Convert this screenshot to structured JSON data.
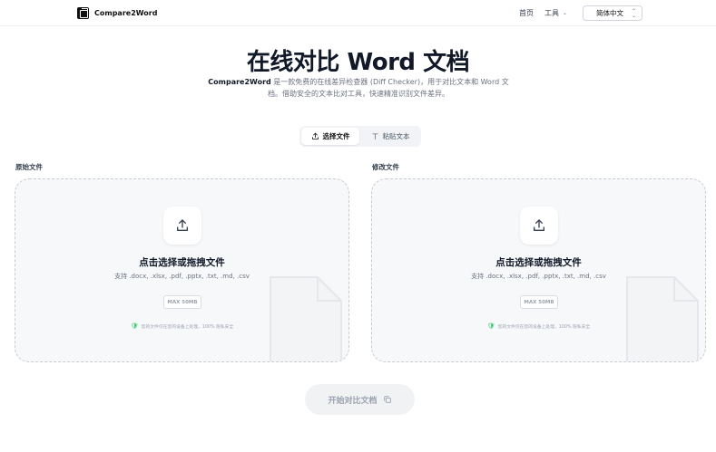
{
  "header": {
    "brand": "Compare2Word",
    "nav_home": "首页",
    "nav_tools": "工具",
    "language": "简体中文"
  },
  "hero": {
    "title": "在线对比 Word 文档",
    "subtitle_brand": "Compare2Word",
    "subtitle_rest": " 是一款免费的在线差异检查器 (Diff Checker)，用于对比文本和 Word 文档。借助安全的文本比对工具，快速精准识别文件差异。"
  },
  "mode_toggle": {
    "file_tab": "选择文件",
    "paste_tab": "粘贴文本",
    "active": "file"
  },
  "panels": {
    "original": {
      "label": "原始文件",
      "drop_title": "点击选择或拖拽文件",
      "formats": "支持 .docx, .xlsx, .pdf, .pptx, .txt, .md, .csv",
      "max_size": "MAX 50MB",
      "secure_note": "您的文件仅在您的设备上处理，100% 隐私安全"
    },
    "modified": {
      "label": "修改文件",
      "drop_title": "点击选择或拖拽文件",
      "formats": "支持 .docx, .xlsx, .pdf, .pptx, .txt, .md, .csv",
      "max_size": "MAX 50MB",
      "secure_note": "您的文件仅在您的设备上处理，100% 隐私安全"
    }
  },
  "compare_button": "开始对比文档",
  "colors": {
    "text_primary": "#111827",
    "muted": "#6b7280",
    "drop_bg": "#f7f8fa",
    "shield": "#22c55e"
  }
}
